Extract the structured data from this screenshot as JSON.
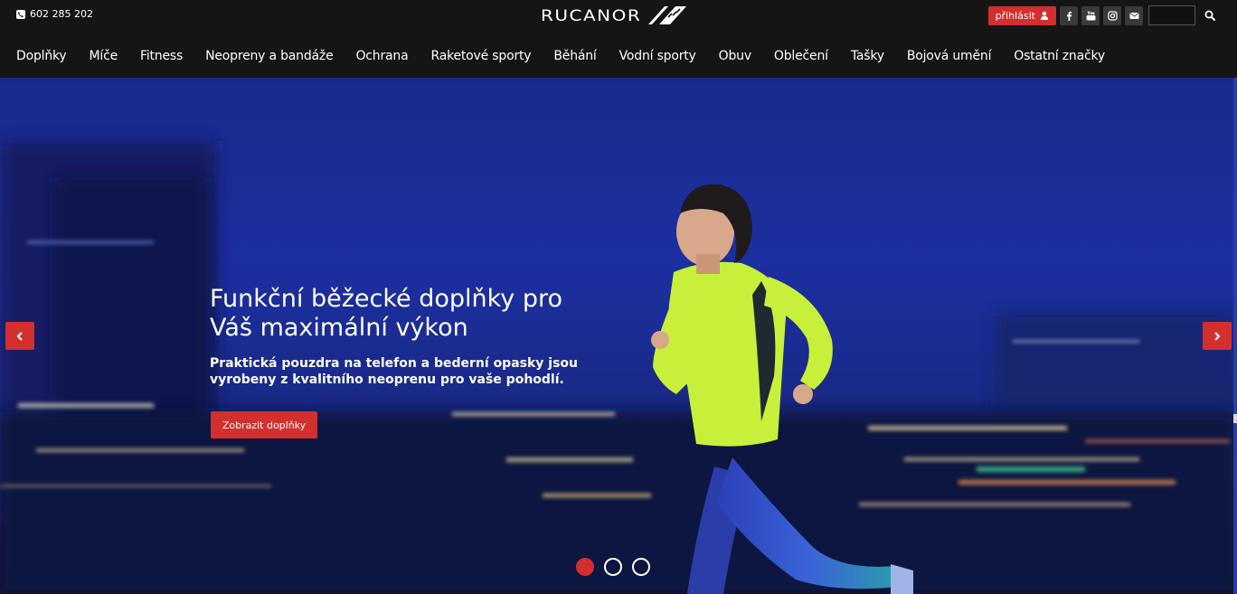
{
  "topbar": {
    "phone": "602 285 202",
    "logo_text": "RUCANOR",
    "login_label": "přihlásit",
    "social_icons": [
      "facebook-icon",
      "youtube-icon",
      "instagram-icon",
      "envelope-icon"
    ],
    "search_placeholder": ""
  },
  "nav": {
    "items": [
      "Doplňky",
      "Míče",
      "Fitness",
      "Neopreny a bandáže",
      "Ochrana",
      "Raketové sporty",
      "Běhání",
      "Vodní sporty",
      "Obuv",
      "Oblečení",
      "Tašky",
      "Bojová umění",
      "Ostatní značky"
    ]
  },
  "hero": {
    "title": "Funkční běžecké doplňky pro Váš maximální výkon",
    "subtitle": "Praktická pouzdra na telefon a bederní opasky jsou vyrobeny z kvalitního neoprenu pro vaše pohodlí.",
    "cta_label": "Zobrazit doplňky",
    "slides_total": 3,
    "active_slide": 1
  },
  "colors": {
    "accent": "#d32f2f",
    "bar_background": "#151515",
    "hero_blue": "#1c2fa0",
    "jacket": "#c8f03a"
  }
}
